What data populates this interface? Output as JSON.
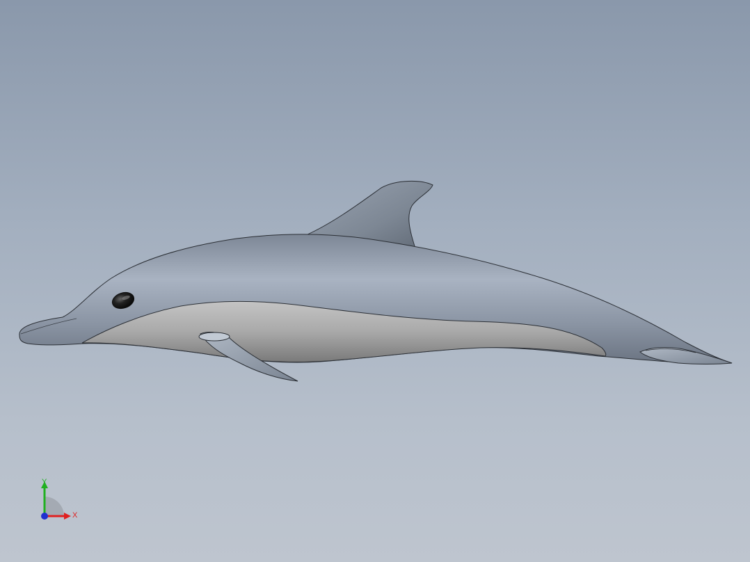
{
  "viewport": {
    "background_top": "#8a98ab",
    "background_bottom": "#bec5cf"
  },
  "model": {
    "body_color": "#8892a0",
    "belly_color": "#a8a8a8",
    "fin_color": "#7f8a98",
    "eye_color": "#1a1a1a"
  },
  "triad": {
    "x_label": "X",
    "y_label": "Y",
    "x_color": "#e02020",
    "y_color": "#20b020",
    "z_color": "#2030d0"
  }
}
